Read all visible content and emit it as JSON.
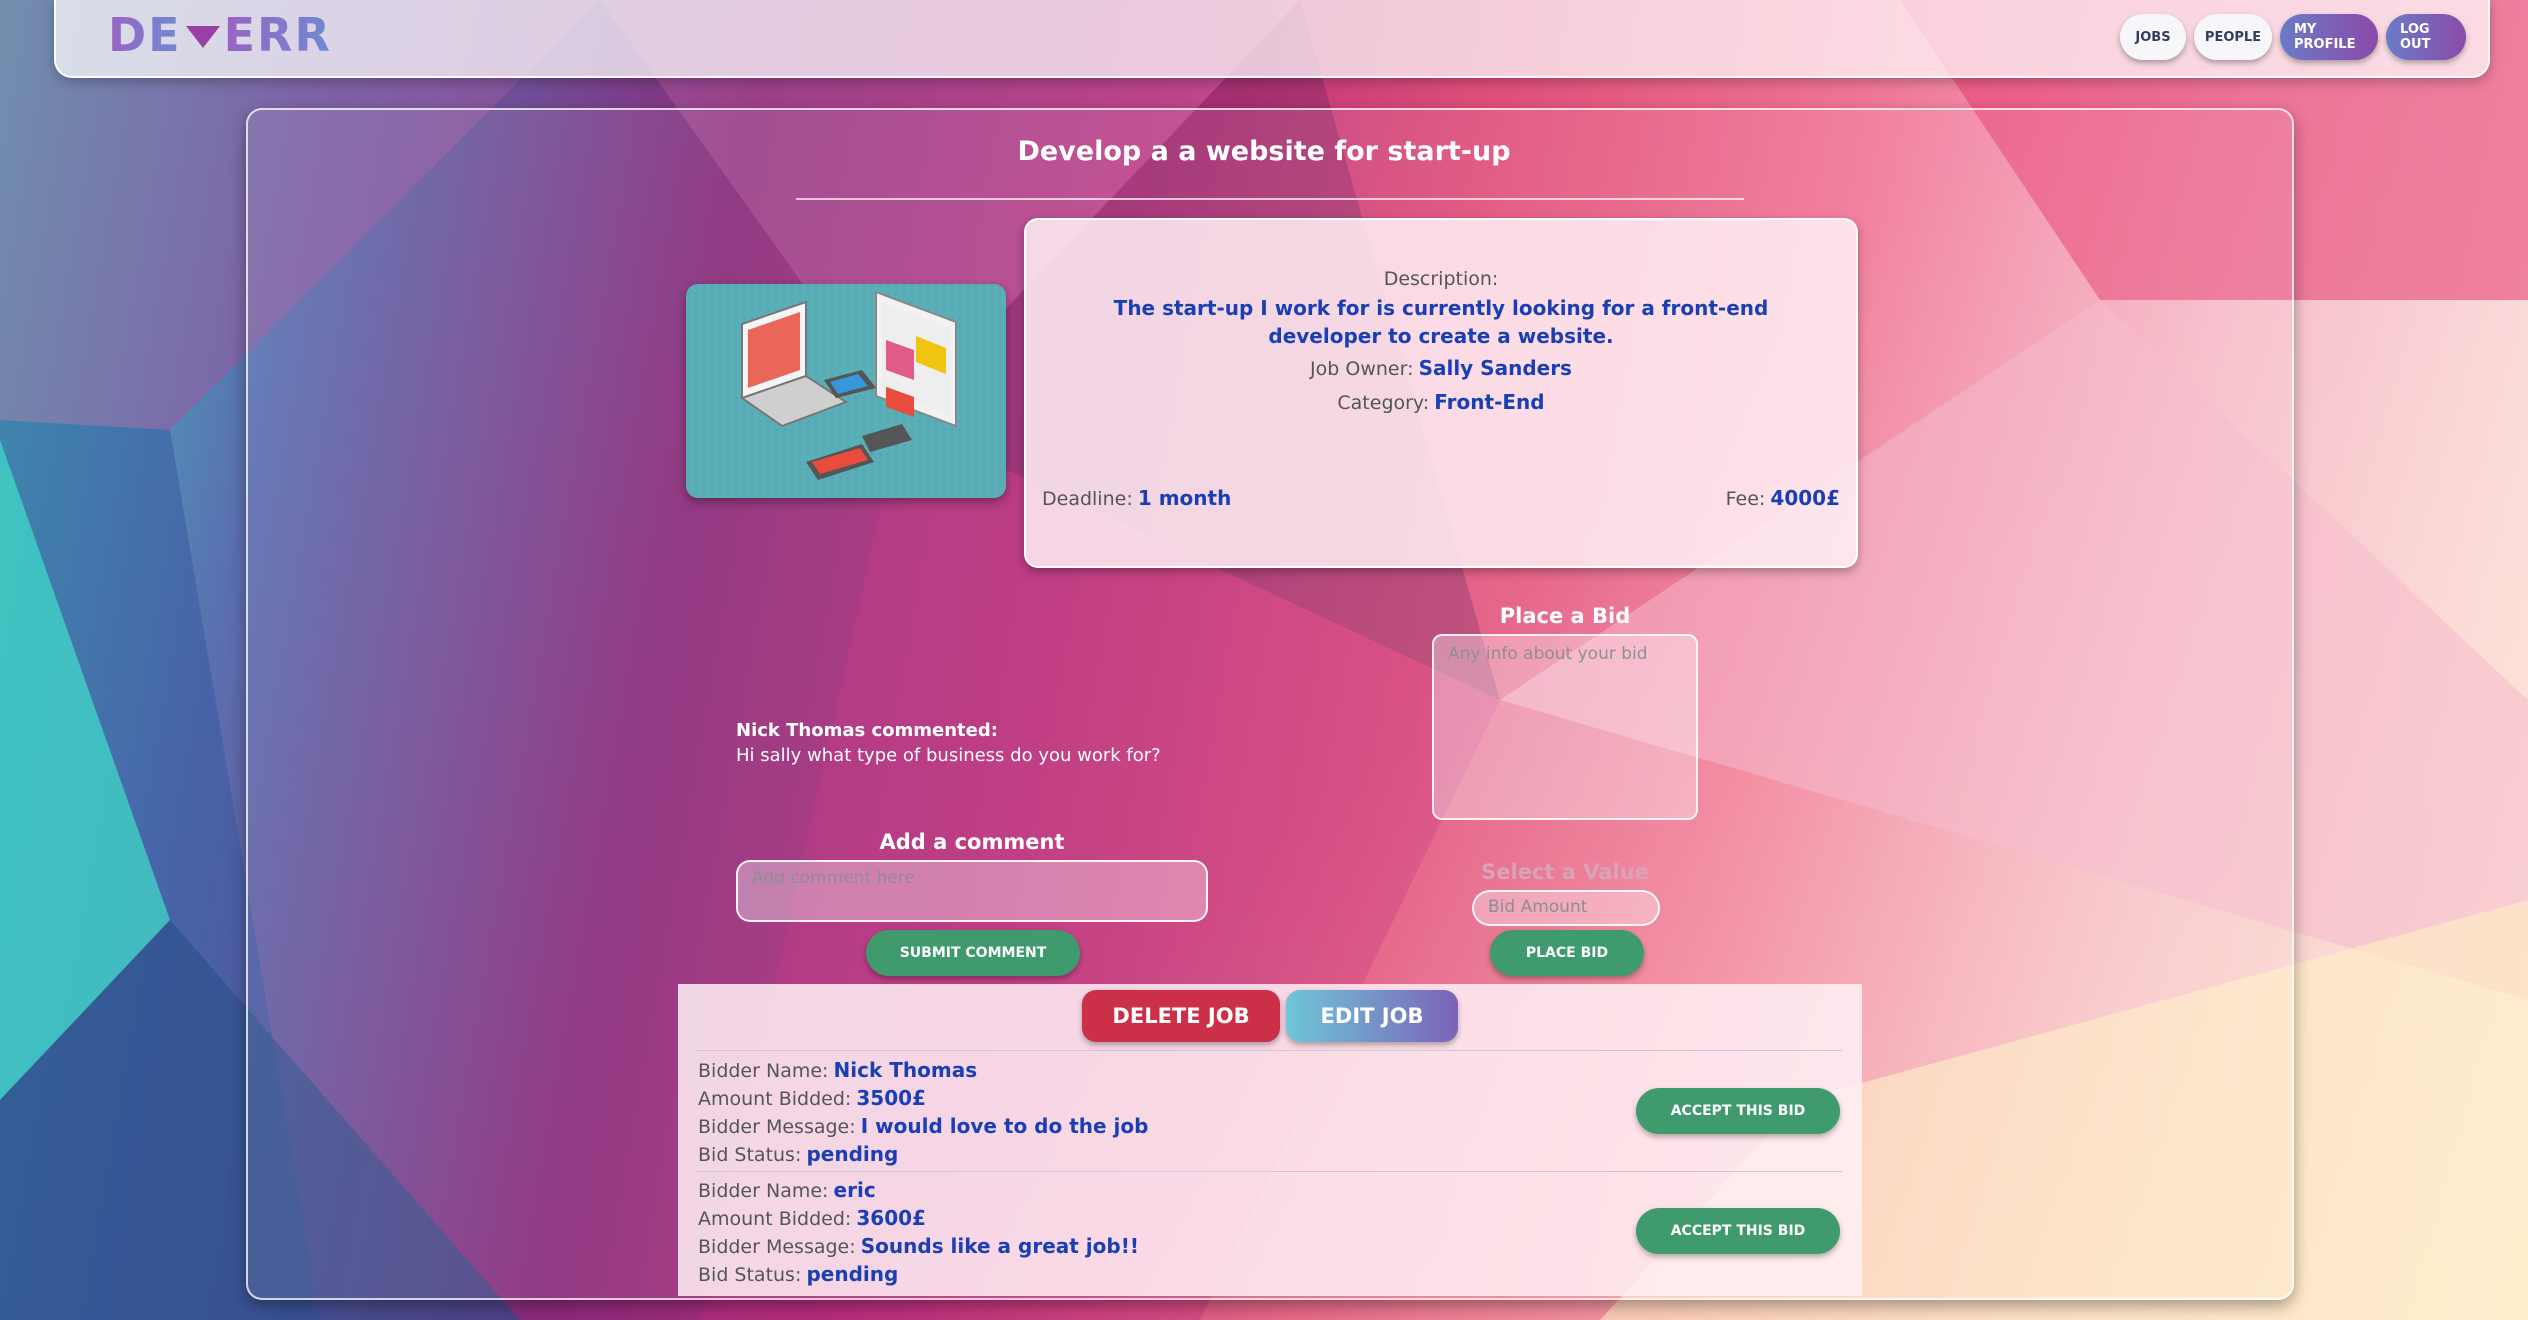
{
  "logo": {
    "left": "DE",
    "right": "ERR"
  },
  "nav": {
    "jobs": "JOBS",
    "people": "PEOPLE",
    "my_profile": "MY PROFILE",
    "log_out": "LOG OUT"
  },
  "job": {
    "title": "Develop a a website for start-up",
    "description_label": "Description:",
    "description": "The start-up I work for is currently looking for a front-end developer to create a website.",
    "owner_label": "Job Owner:",
    "owner": "Sally Sanders",
    "category_label": "Category:",
    "category": "Front-End",
    "deadline_label": "Deadline:",
    "deadline": "1 month",
    "fee_label": "Fee:",
    "fee": "4000£"
  },
  "bid_form": {
    "title": "Place a Bid",
    "info_placeholder": "Any info about your bid",
    "select_value_label": "Select a Value",
    "amount_placeholder": "Bid Amount",
    "submit_label": "PLACE BID"
  },
  "comments": [
    {
      "author": "Nick Thomas commented:",
      "text": "Hi sally what type of business do you work for?"
    }
  ],
  "comment_form": {
    "title": "Add a comment",
    "placeholder": "Add comment here",
    "submit_label": "SUBMIT COMMENT"
  },
  "owner_actions": {
    "delete_label": "DELETE JOB",
    "edit_label": "EDIT JOB"
  },
  "bid_labels": {
    "name": "Bidder Name:",
    "amount": "Amount Bidded:",
    "message": "Bidder Message:",
    "status": "Bid Status:",
    "accept": "ACCEPT THIS BID"
  },
  "bids": [
    {
      "name": "Nick Thomas",
      "amount": "3500£",
      "message": "I would love to do the job",
      "status": "pending"
    },
    {
      "name": "eric",
      "amount": "3600£",
      "message": "Sounds like a great job!!",
      "status": "pending"
    }
  ],
  "colors": {
    "accent_blue": "#1a3fb5",
    "green": "#3f9a6e",
    "red": "#cc3048"
  }
}
